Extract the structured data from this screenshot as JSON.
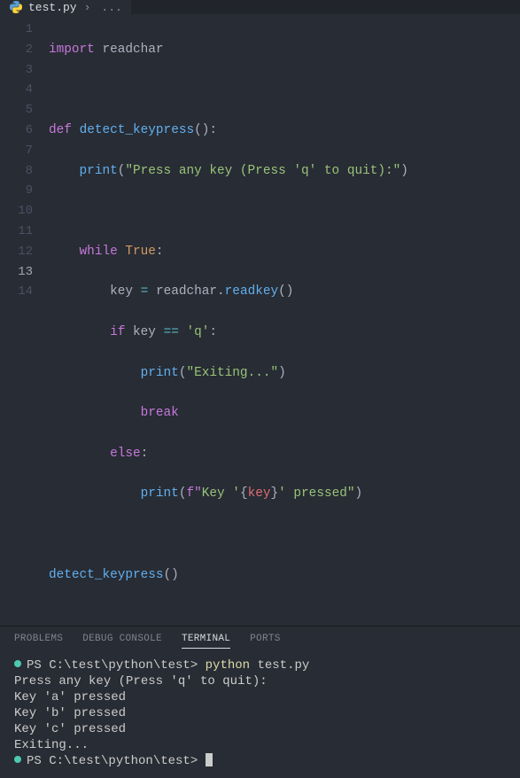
{
  "tab": {
    "filename": "test.py",
    "breadcrumb_sep": "›",
    "breadcrumb_more": "..."
  },
  "editor": {
    "lines": [
      1,
      2,
      3,
      4,
      5,
      6,
      7,
      8,
      9,
      10,
      11,
      12,
      13,
      14
    ],
    "current_line": 13
  },
  "code": {
    "l1_import": "import",
    "l1_mod": "readchar",
    "l3_def": "def",
    "l3_fname": "detect_keypress",
    "l3_parens": "()",
    "l3_colon": ":",
    "l4_print": "print",
    "l4_str": "\"Press any key (Press 'q' to quit):\"",
    "l6_while": "while",
    "l6_true": "True",
    "l6_colon": ":",
    "l7_key": "key",
    "l7_eq": "=",
    "l7_readchar": "readchar",
    "l7_dot": ".",
    "l7_readkey": "readkey",
    "l7_parens": "()",
    "l8_if": "if",
    "l8_key": "key",
    "l8_eqeq": "==",
    "l8_q": "'q'",
    "l8_colon": ":",
    "l9_print": "print",
    "l9_str": "\"Exiting...\"",
    "l10_break": "break",
    "l11_else": "else",
    "l11_colon": ":",
    "l12_print": "print",
    "l12_f": "f\"",
    "l12_s1": "Key '",
    "l12_lb": "{",
    "l12_kv": "key",
    "l12_rb": "}",
    "l12_s2": "' pressed",
    "l12_end": "\"",
    "l14_call": "detect_keypress",
    "l14_parens": "()"
  },
  "panel": {
    "tabs": {
      "problems": "PROBLEMS",
      "debug": "DEBUG CONSOLE",
      "terminal": "TERMINAL",
      "ports": "PORTS"
    }
  },
  "terminal": {
    "prompt1_path": "PS C:\\test\\python\\test>",
    "prompt1_cmd": "python",
    "prompt1_arg": "test.py",
    "out1": "Press any key (Press 'q' to quit):",
    "out2": "Key 'a' pressed",
    "out3": "Key 'b' pressed",
    "out4": "Key 'c' pressed",
    "out5": "Exiting...",
    "prompt2_path": "PS C:\\test\\python\\test>"
  }
}
